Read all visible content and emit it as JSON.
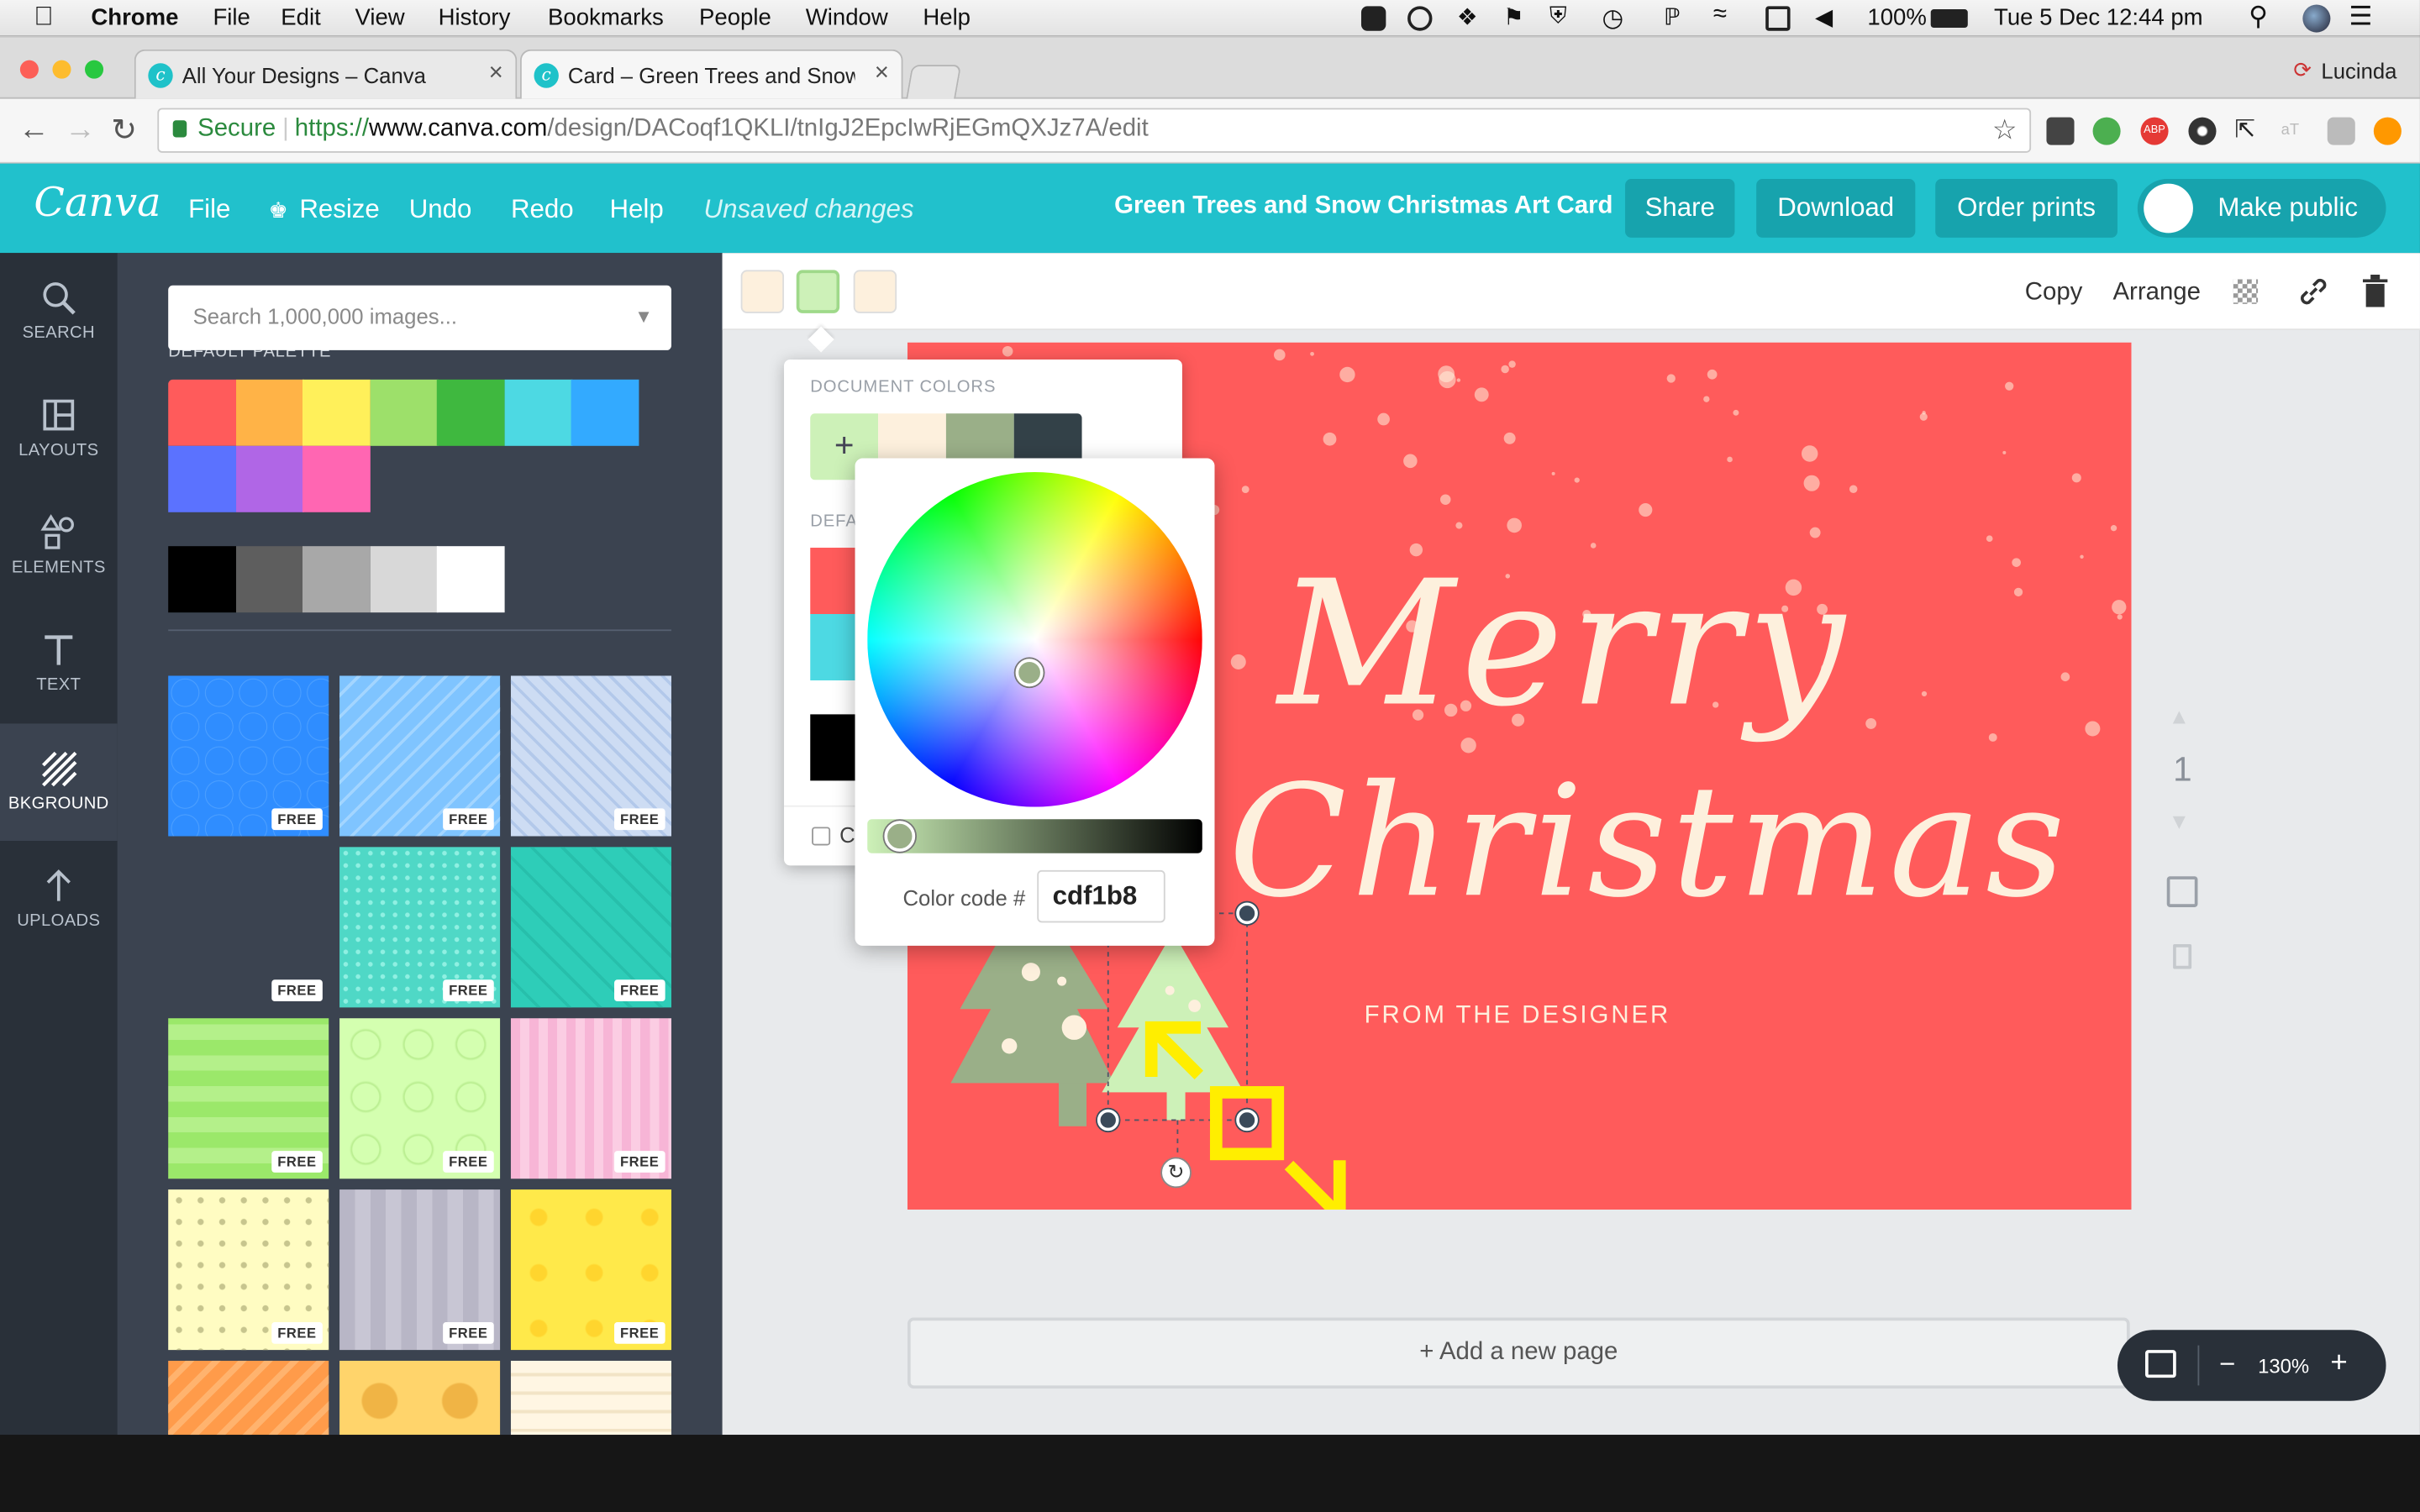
{
  "menubar": {
    "app": "Chrome",
    "items": [
      "File",
      "Edit",
      "View",
      "History",
      "Bookmarks",
      "People",
      "Window",
      "Help"
    ],
    "battery": "100%",
    "datetime": "Tue 5 Dec  12:44 pm"
  },
  "browser": {
    "tabs": [
      {
        "title": "All Your Designs – Canva",
        "active": false
      },
      {
        "title": "Card – Green Trees and Snow C",
        "active": true
      }
    ],
    "profile": "Lucinda",
    "secure_label": "Secure",
    "url_prefix": "https://",
    "url_host": "www.canva.com",
    "url_path": "/design/DACoqf1QKLI/tnIgJ2EpcIwRjEGmQXJz7A/edit"
  },
  "canva_header": {
    "logo": "Canva",
    "file": "File",
    "resize": "Resize",
    "undo": "Undo",
    "redo": "Redo",
    "help": "Help",
    "status": "Unsaved changes",
    "design_title": "Green Trees and Snow Christmas Art Card",
    "share": "Share",
    "download": "Download",
    "order_prints": "Order prints",
    "make_public": "Make public"
  },
  "left_nav": [
    {
      "label": "SEARCH",
      "icon": "search-icon"
    },
    {
      "label": "LAYOUTS",
      "icon": "layouts-icon"
    },
    {
      "label": "ELEMENTS",
      "icon": "elements-icon"
    },
    {
      "label": "TEXT",
      "icon": "text-icon"
    },
    {
      "label": "BKGROUND",
      "icon": "background-icon",
      "active": true
    },
    {
      "label": "UPLOADS",
      "icon": "uploads-icon"
    }
  ],
  "bg_panel": {
    "search_placeholder": "Search 1,000,000 images...",
    "palette_label": "DEFAULT PALETTE",
    "palette": [
      "#ff5b5b",
      "#ffb347",
      "#fff05a",
      "#9de06a",
      "#3fb83f",
      "#4dd9e3",
      "#33aaff",
      "#5b72ff",
      "#b066e6",
      "#ff66b2"
    ],
    "grays": [
      "#000000",
      "#5e5e5e",
      "#a8a8a8",
      "#d8d8d8",
      "#ffffff"
    ],
    "free_label": "FREE",
    "thumbs": [
      "blue-hex",
      "blue-zigzag",
      "blue-diagonal",
      "mint-diamond",
      "teal-dots",
      "teal-stripe",
      "green-stripe",
      "lime-circles",
      "pink-stripe",
      "yellow-dots",
      "gray-stripe",
      "yellow-lemon",
      "orange-zigzag",
      "yellow-circle",
      "cream-lines"
    ]
  },
  "toolbar": {
    "colors": [
      "#fdf0dd",
      "#cdf1b8",
      "#fdf0dd"
    ],
    "copy": "Copy",
    "arrange": "Arrange"
  },
  "color_popup": {
    "document_colors_label": "DOCUMENT COLORS",
    "document_colors": [
      "#cdf1b8",
      "#fdf0dd",
      "#9aaf88",
      "#334148"
    ],
    "default_label": "DEFA",
    "checkbox_label": "C",
    "color_code_label": "Color code #",
    "color_code": "cdf1b8"
  },
  "design": {
    "line1": "Merry",
    "line2": "Christmas",
    "subtitle": "FROM THE DESIGNER",
    "bg": "#ff5b5b",
    "text_color": "#fdf0dd"
  },
  "page_controls": {
    "page_number": "1",
    "add_page": "+ Add a new page",
    "zoom": "130%"
  }
}
